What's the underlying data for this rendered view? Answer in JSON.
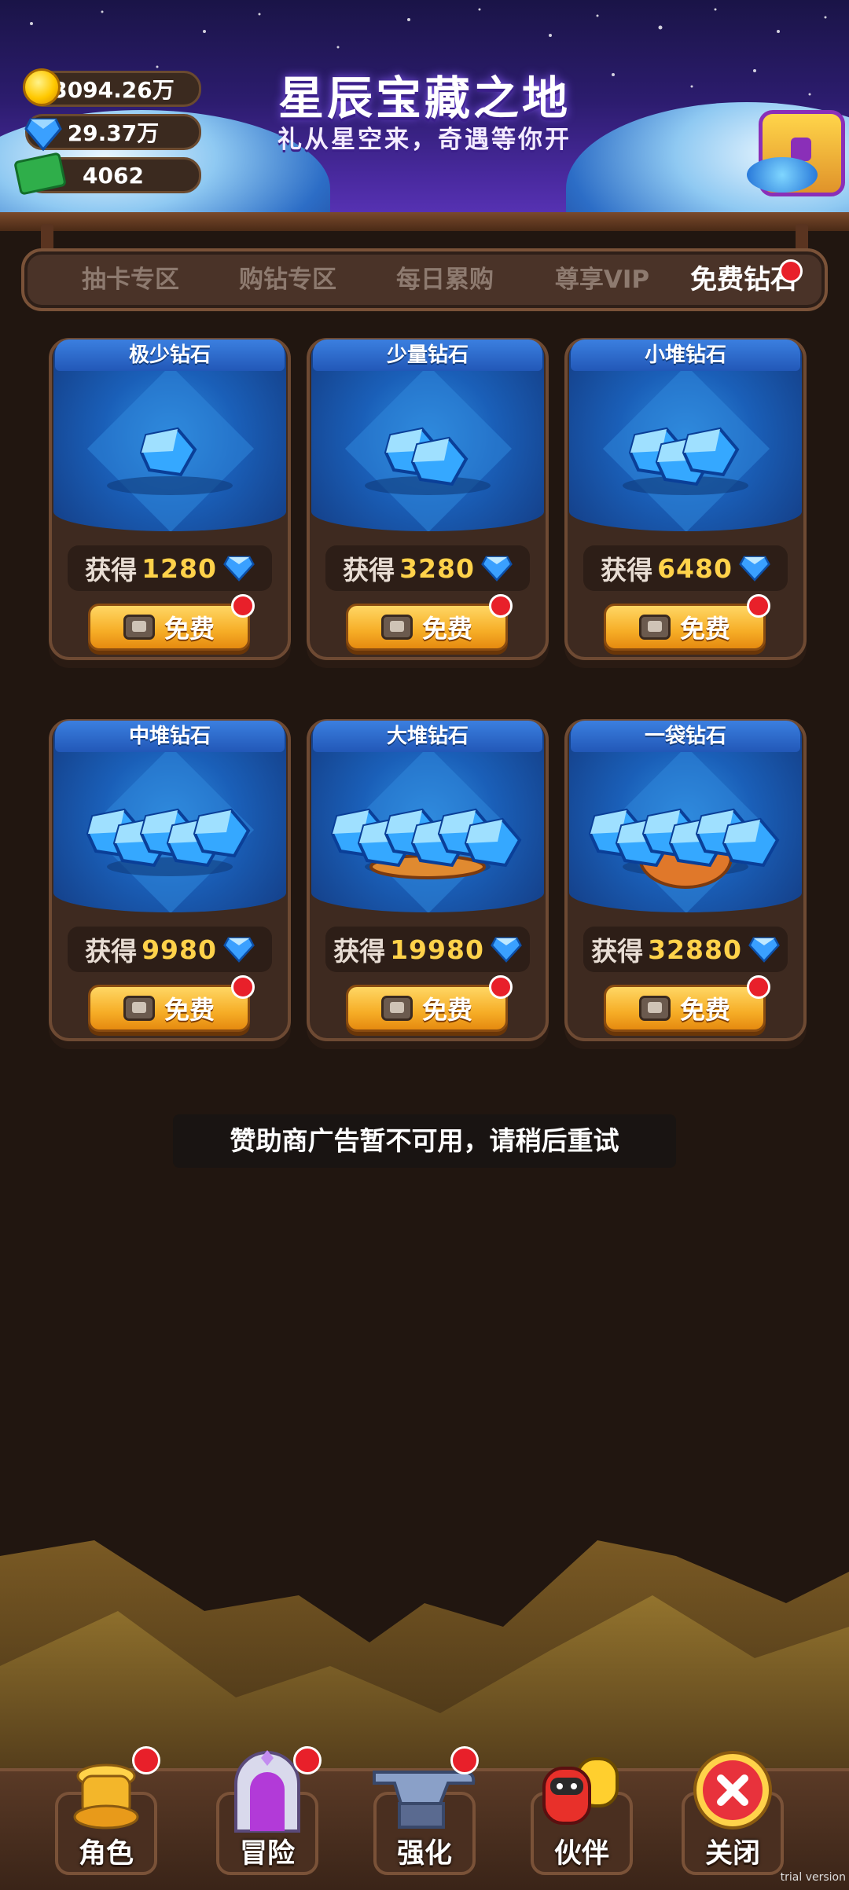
{
  "header": {
    "title": "星辰宝藏之地",
    "subtitle": "礼从星空来，奇遇等你开"
  },
  "currencies": {
    "coins": "3094.26万",
    "diamonds": "29.37万",
    "cash": "4062"
  },
  "tabs": [
    {
      "label": "抽卡专区",
      "active": false
    },
    {
      "label": "购钻专区",
      "active": false
    },
    {
      "label": "每日累购",
      "active": false
    },
    {
      "label": "尊享VIP",
      "active": false
    },
    {
      "label": "免费钻石",
      "active": true,
      "badge": true
    }
  ],
  "cards": [
    {
      "title": "极少钻石",
      "reward_label": "获得",
      "amount": "1280",
      "button": "免费"
    },
    {
      "title": "少量钻石",
      "reward_label": "获得",
      "amount": "3280",
      "button": "免费"
    },
    {
      "title": "小堆钻石",
      "reward_label": "获得",
      "amount": "6480",
      "button": "免费"
    },
    {
      "title": "中堆钻石",
      "reward_label": "获得",
      "amount": "9980",
      "button": "免费"
    },
    {
      "title": "大堆钻石",
      "reward_label": "获得",
      "amount": "19980",
      "button": "免费"
    },
    {
      "title": "一袋钻石",
      "reward_label": "获得",
      "amount": "32880",
      "button": "免费"
    }
  ],
  "toast": "赞助商广告暂不可用，请稍后重试",
  "nav": [
    {
      "label": "角色",
      "icon": "character-icon"
    },
    {
      "label": "冒险",
      "icon": "adventure-gate-icon"
    },
    {
      "label": "强化",
      "icon": "anvil-icon"
    },
    {
      "label": "伙伴",
      "icon": "partner-icon"
    },
    {
      "label": "关闭",
      "icon": "close-icon"
    }
  ],
  "watermark": "trial version",
  "colors": {
    "background": "#211610",
    "gold_text": "#ffd24a",
    "button_orange": "#f6ad26",
    "badge_red": "#e8202a",
    "card_blue": "#1a5fb8"
  }
}
